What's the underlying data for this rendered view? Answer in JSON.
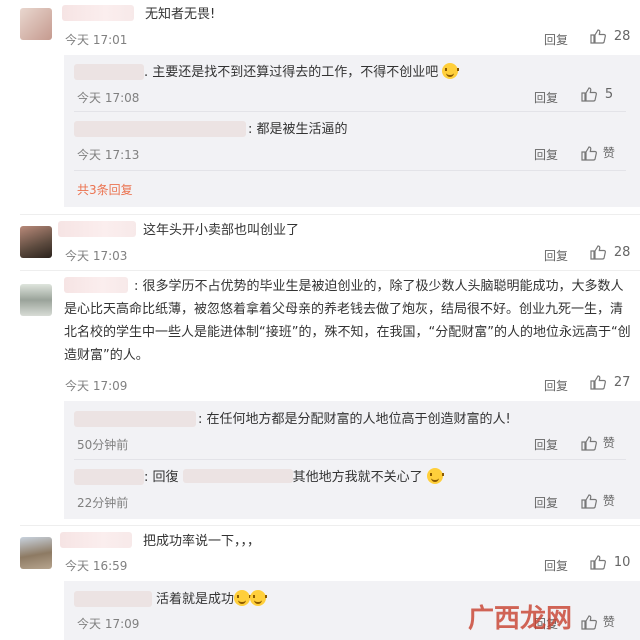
{
  "comments": [
    {
      "text": "无知者无畏!",
      "time": "今天 17:01",
      "reply": "回复",
      "likes": "28",
      "subs": [
        {
          "text": ". 主要还是找不到还算过得去的工作，不得不创业吧",
          "time": "今天 17:08",
          "reply": "回复",
          "likes": "5",
          "emoji": "laugh-cry-emoji"
        },
        {
          "text": ": 都是被生活逼的",
          "time": "今天 17:13",
          "reply": "回复",
          "likes": "赞"
        }
      ],
      "more": "共3条回复"
    },
    {
      "text": "这年头开小卖部也叫创业了",
      "time": "今天 17:03",
      "reply": "回复",
      "likes": "28"
    },
    {
      "text_lines": [
        ": 很多学历不占优势的毕业生是被迫创业的，除了极少数人头脑聪明能成功，大多数人",
        "是心比天高命比纸薄，被忽悠着拿着父母亲的养老钱去做了炮灰，结局很不好。创业九死一生，清",
        "北名校的学生中一些人是能进体制“接班”的，殊不知，在我国，“分配财富”的人的地位永远高于“创",
        "造财富”的人。"
      ],
      "time": "今天 17:09",
      "reply": "回复",
      "likes": "27",
      "subs": [
        {
          "text": ": 在任何地方都是分配财富的人地位高于创造财富的人!",
          "time": "50分钟前",
          "reply": "回复",
          "likes": "赞"
        },
        {
          "text_a": ": 回復",
          "text_b": "其他地方我就不关心了",
          "time": "22分钟前",
          "reply": "回复",
          "likes": "赞",
          "emoji": "grin-emoji"
        }
      ]
    },
    {
      "text": "把成功率说一下，，，",
      "time": "今天 16:59",
      "reply": "回复",
      "likes": "10",
      "subs": [
        {
          "text": "活着就是成功",
          "time": "今天 17:09",
          "reply": "回复",
          "likes": "赞",
          "emoji": "laugh-cry-emoji"
        }
      ]
    }
  ],
  "watermark": "广西龙网"
}
